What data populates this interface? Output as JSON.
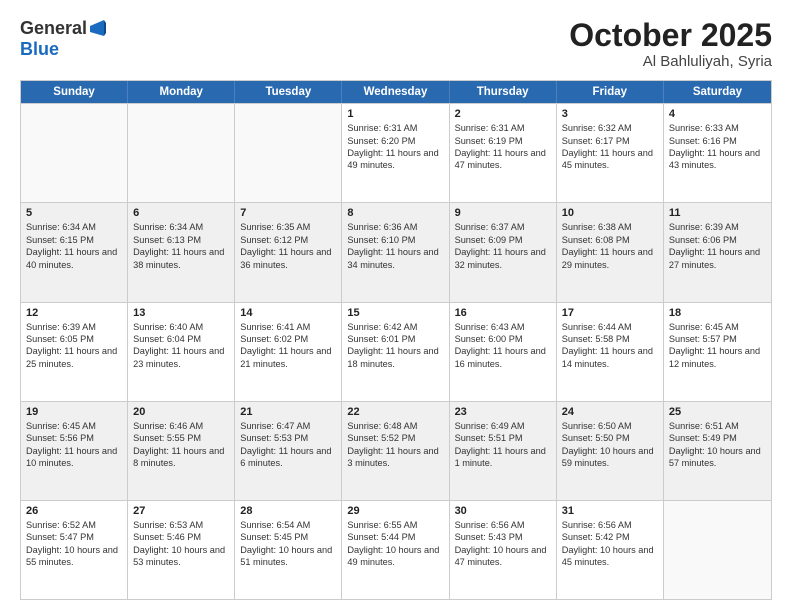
{
  "header": {
    "logo_line1": "General",
    "logo_line2": "Blue",
    "month": "October 2025",
    "location": "Al Bahluliyah, Syria"
  },
  "days": [
    "Sunday",
    "Monday",
    "Tuesday",
    "Wednesday",
    "Thursday",
    "Friday",
    "Saturday"
  ],
  "weeks": [
    [
      {
        "day": "",
        "empty": true
      },
      {
        "day": "",
        "empty": true
      },
      {
        "day": "",
        "empty": true
      },
      {
        "day": "1",
        "sunrise": "6:31 AM",
        "sunset": "6:20 PM",
        "daylight": "11 hours and 49 minutes."
      },
      {
        "day": "2",
        "sunrise": "6:31 AM",
        "sunset": "6:19 PM",
        "daylight": "11 hours and 47 minutes."
      },
      {
        "day": "3",
        "sunrise": "6:32 AM",
        "sunset": "6:17 PM",
        "daylight": "11 hours and 45 minutes."
      },
      {
        "day": "4",
        "sunrise": "6:33 AM",
        "sunset": "6:16 PM",
        "daylight": "11 hours and 43 minutes."
      }
    ],
    [
      {
        "day": "5",
        "sunrise": "6:34 AM",
        "sunset": "6:15 PM",
        "daylight": "11 hours and 40 minutes."
      },
      {
        "day": "6",
        "sunrise": "6:34 AM",
        "sunset": "6:13 PM",
        "daylight": "11 hours and 38 minutes."
      },
      {
        "day": "7",
        "sunrise": "6:35 AM",
        "sunset": "6:12 PM",
        "daylight": "11 hours and 36 minutes."
      },
      {
        "day": "8",
        "sunrise": "6:36 AM",
        "sunset": "6:10 PM",
        "daylight": "11 hours and 34 minutes."
      },
      {
        "day": "9",
        "sunrise": "6:37 AM",
        "sunset": "6:09 PM",
        "daylight": "11 hours and 32 minutes."
      },
      {
        "day": "10",
        "sunrise": "6:38 AM",
        "sunset": "6:08 PM",
        "daylight": "11 hours and 29 minutes."
      },
      {
        "day": "11",
        "sunrise": "6:39 AM",
        "sunset": "6:06 PM",
        "daylight": "11 hours and 27 minutes."
      }
    ],
    [
      {
        "day": "12",
        "sunrise": "6:39 AM",
        "sunset": "6:05 PM",
        "daylight": "11 hours and 25 minutes."
      },
      {
        "day": "13",
        "sunrise": "6:40 AM",
        "sunset": "6:04 PM",
        "daylight": "11 hours and 23 minutes."
      },
      {
        "day": "14",
        "sunrise": "6:41 AM",
        "sunset": "6:02 PM",
        "daylight": "11 hours and 21 minutes."
      },
      {
        "day": "15",
        "sunrise": "6:42 AM",
        "sunset": "6:01 PM",
        "daylight": "11 hours and 18 minutes."
      },
      {
        "day": "16",
        "sunrise": "6:43 AM",
        "sunset": "6:00 PM",
        "daylight": "11 hours and 16 minutes."
      },
      {
        "day": "17",
        "sunrise": "6:44 AM",
        "sunset": "5:58 PM",
        "daylight": "11 hours and 14 minutes."
      },
      {
        "day": "18",
        "sunrise": "6:45 AM",
        "sunset": "5:57 PM",
        "daylight": "11 hours and 12 minutes."
      }
    ],
    [
      {
        "day": "19",
        "sunrise": "6:45 AM",
        "sunset": "5:56 PM",
        "daylight": "11 hours and 10 minutes."
      },
      {
        "day": "20",
        "sunrise": "6:46 AM",
        "sunset": "5:55 PM",
        "daylight": "11 hours and 8 minutes."
      },
      {
        "day": "21",
        "sunrise": "6:47 AM",
        "sunset": "5:53 PM",
        "daylight": "11 hours and 6 minutes."
      },
      {
        "day": "22",
        "sunrise": "6:48 AM",
        "sunset": "5:52 PM",
        "daylight": "11 hours and 3 minutes."
      },
      {
        "day": "23",
        "sunrise": "6:49 AM",
        "sunset": "5:51 PM",
        "daylight": "11 hours and 1 minute."
      },
      {
        "day": "24",
        "sunrise": "6:50 AM",
        "sunset": "5:50 PM",
        "daylight": "10 hours and 59 minutes."
      },
      {
        "day": "25",
        "sunrise": "6:51 AM",
        "sunset": "5:49 PM",
        "daylight": "10 hours and 57 minutes."
      }
    ],
    [
      {
        "day": "26",
        "sunrise": "6:52 AM",
        "sunset": "5:47 PM",
        "daylight": "10 hours and 55 minutes."
      },
      {
        "day": "27",
        "sunrise": "6:53 AM",
        "sunset": "5:46 PM",
        "daylight": "10 hours and 53 minutes."
      },
      {
        "day": "28",
        "sunrise": "6:54 AM",
        "sunset": "5:45 PM",
        "daylight": "10 hours and 51 minutes."
      },
      {
        "day": "29",
        "sunrise": "6:55 AM",
        "sunset": "5:44 PM",
        "daylight": "10 hours and 49 minutes."
      },
      {
        "day": "30",
        "sunrise": "6:56 AM",
        "sunset": "5:43 PM",
        "daylight": "10 hours and 47 minutes."
      },
      {
        "day": "31",
        "sunrise": "6:56 AM",
        "sunset": "5:42 PM",
        "daylight": "10 hours and 45 minutes."
      },
      {
        "day": "",
        "empty": true
      }
    ]
  ]
}
